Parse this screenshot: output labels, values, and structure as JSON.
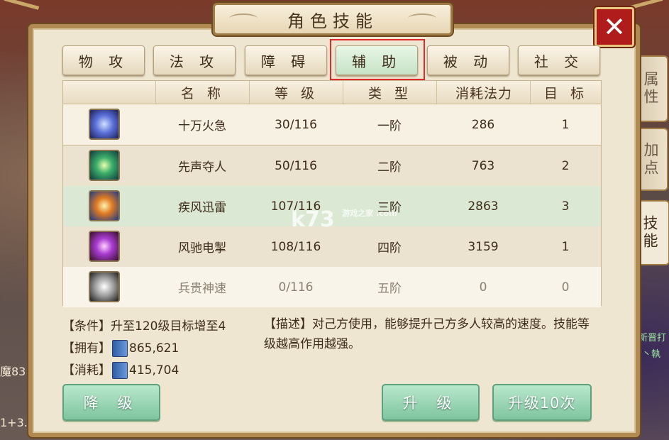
{
  "title": "角色技能",
  "close_label": "✕",
  "tabs": [
    "物 攻",
    "法 攻",
    "障 碍",
    "辅 助",
    "被 动",
    "社 交"
  ],
  "active_tab": 3,
  "table": {
    "headers": [
      "名 称",
      "等 级",
      "类 型",
      "消耗法力",
      "目 标"
    ],
    "rows": [
      {
        "name": "十万火急",
        "level": "30/116",
        "tier": "一阶",
        "mana": "286",
        "target": "1",
        "icon": "lightning-wing-icon"
      },
      {
        "name": "先声夺人",
        "level": "50/116",
        "tier": "二阶",
        "mana": "763",
        "target": "2",
        "icon": "green-spark-icon"
      },
      {
        "name": "疾风迅雷",
        "level": "107/116",
        "tier": "三阶",
        "mana": "2863",
        "target": "3",
        "icon": "flame-crest-icon"
      },
      {
        "name": "风驰电掣",
        "level": "108/116",
        "tier": "四阶",
        "mana": "3159",
        "target": "1",
        "icon": "purple-swirl-icon"
      },
      {
        "name": "兵贵神速",
        "level": "0/116",
        "tier": "五阶",
        "mana": "0",
        "target": "0",
        "icon": "white-burst-icon"
      }
    ]
  },
  "info": {
    "condition": "【条件】升至120级目标增至4",
    "owned_label": "【拥有】",
    "owned_value": "865,621",
    "cost_label": "【消耗】",
    "cost_value": "415,704",
    "description": "【描述】对己方使用，能够提升己方多人较高的速度。技能等级越高作用越强。"
  },
  "buttons": {
    "downgrade": "降 级",
    "upgrade": "升 级",
    "upgrade10": "升级10次"
  },
  "side_tabs": [
    "属性",
    "加点",
    "技能"
  ],
  "background_text": {
    "left_1": "魔83",
    "left_2": "1+3.",
    "right_1": "新晋打",
    "right_2": "丶執"
  },
  "watermark": "k73",
  "watermark_sub": "游戏之家 .com",
  "colors": {
    "panel": "#efe6d2",
    "border": "#b08a52",
    "highlight": "#e12a2a",
    "button_green": "#7fc49f",
    "selected_row": "#dbe9d4"
  }
}
